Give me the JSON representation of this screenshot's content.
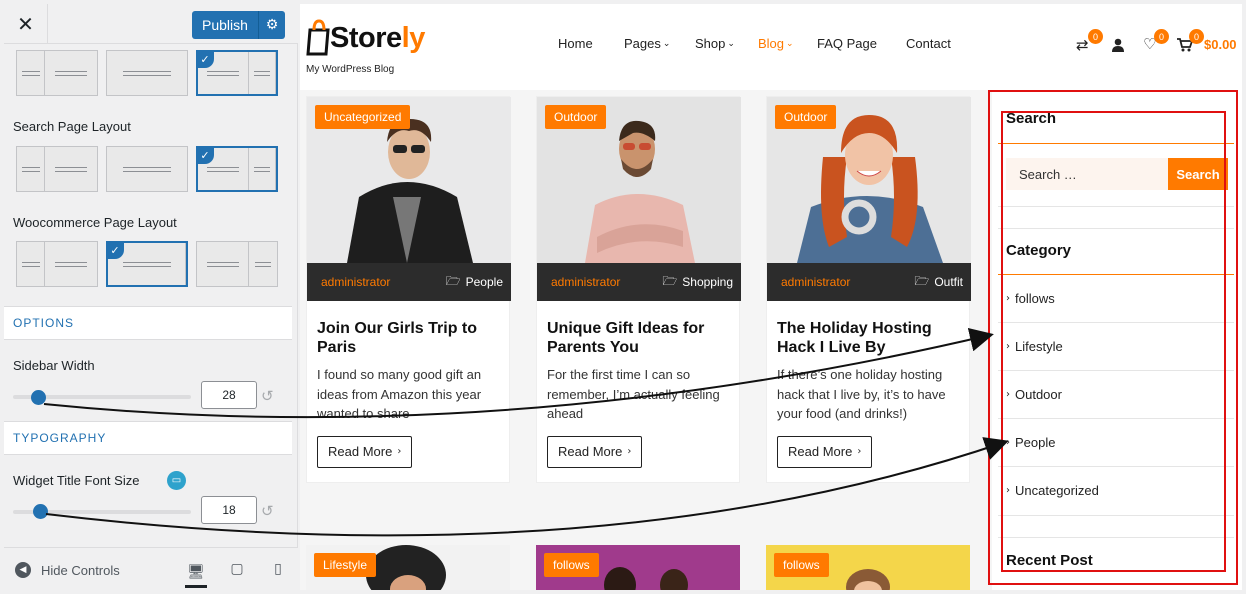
{
  "customizer": {
    "close_glyph": "✕",
    "publish_label": "Publish",
    "gear_glyph": "⚙",
    "search_layout_label": "Search Page Layout",
    "woo_layout_label": "Woocommerce Page Layout",
    "options_heading": "OPTIONS",
    "sidebar_width_label": "Sidebar Width",
    "sidebar_width_value": "28",
    "sidebar_width_fraction": 0.14,
    "typography_heading": "TYPOGRAPHY",
    "widget_font_label": "Widget Title Font Size",
    "widget_font_value": "18",
    "widget_font_fraction": 0.15,
    "hide_controls_label": "Hide Controls",
    "reset_glyph": "↺",
    "check_glyph": "✓",
    "accent": "#2271b1"
  },
  "site": {
    "logo_prefix": "Store",
    "logo_suffix": "ly",
    "tagline": "My WordPress Blog",
    "accent": "#ff7a00",
    "nav": [
      {
        "label": "Home",
        "has_chevron": false,
        "active": false
      },
      {
        "label": "Pages",
        "has_chevron": true,
        "active": false
      },
      {
        "label": "Shop",
        "has_chevron": true,
        "active": false
      },
      {
        "label": "Blog",
        "has_chevron": true,
        "active": true
      },
      {
        "label": "FAQ Page",
        "has_chevron": false,
        "active": false
      },
      {
        "label": "Contact",
        "has_chevron": false,
        "active": false
      }
    ],
    "compare_count": "0",
    "wishlist_count": "0",
    "cart_count": "0",
    "cart_total": "$0.00"
  },
  "posts": [
    {
      "category": "Uncategorized",
      "author": "administrator",
      "tag": "People",
      "title": "Join Our Girls Trip to Paris",
      "excerpt": "I found so many good gift an ideas from Amazon this year wanted to share",
      "read_more": "Read More"
    },
    {
      "category": "Outdoor",
      "author": "administrator",
      "tag": "Shopping",
      "title": "Unique Gift Ideas for Parents You",
      "excerpt": "For the first time I can so remember, I’m actually feeling ahead",
      "read_more": "Read More"
    },
    {
      "category": "Outdoor",
      "author": "administrator",
      "tag": "Outfit",
      "title": "The Holiday Hosting Hack I Live By",
      "excerpt": "If there’s one holiday hosting hack that I live by, it’s to have your food (and drinks!)",
      "read_more": "Read More"
    }
  ],
  "posts_row2": [
    {
      "category": "Lifestyle"
    },
    {
      "category": "follows"
    },
    {
      "category": "follows"
    }
  ],
  "sidebar": {
    "search_title": "Search",
    "search_placeholder": "Search …",
    "search_button": "Search",
    "category_title": "Category",
    "categories": [
      "follows",
      "Lifestyle",
      "Outdoor",
      "People",
      "Uncategorized"
    ],
    "recent_title": "Recent Post"
  }
}
